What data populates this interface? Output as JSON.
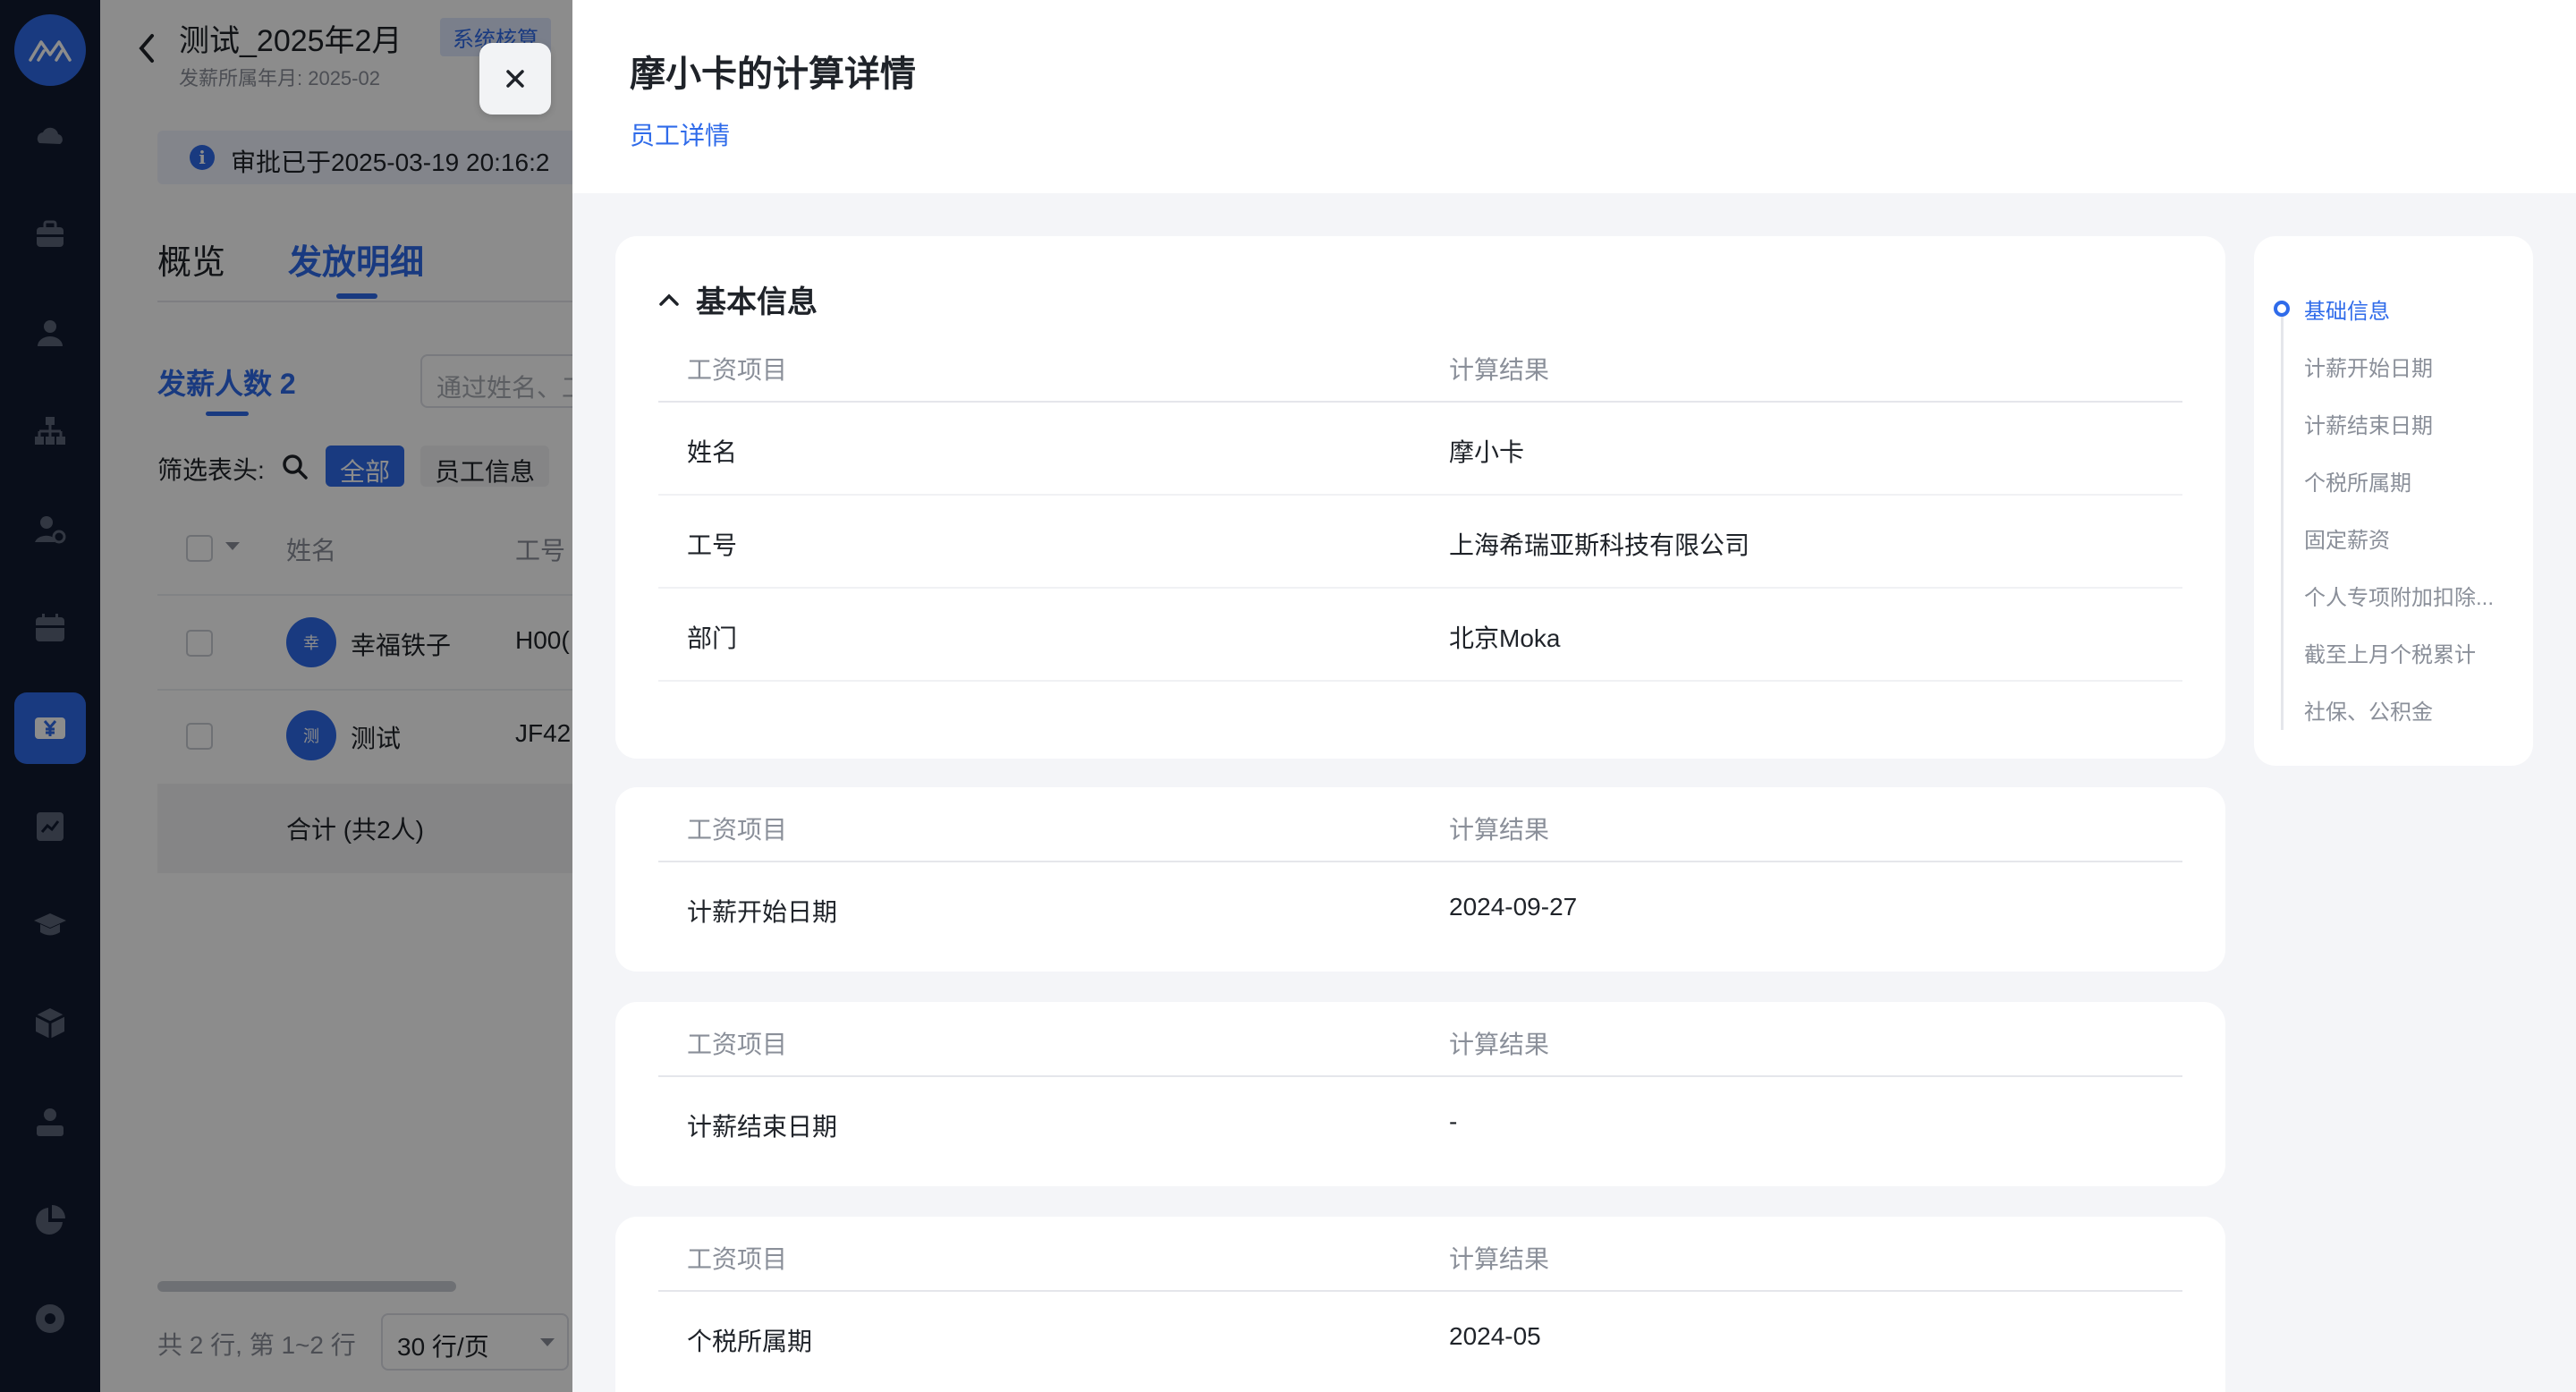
{
  "sidebar": {
    "icons": [
      "logo-icon",
      "cloud-icon",
      "briefcase-icon",
      "user-icon",
      "org-chart-icon",
      "user-settings-icon",
      "calendar-icon",
      "yen-icon",
      "report-icon",
      "graduation-cap-icon",
      "cube-icon",
      "profile-icon",
      "pie-chart-icon",
      "disc-icon"
    ],
    "active_icon": "yen-icon"
  },
  "background_page": {
    "title": "测试_2025年2月",
    "badge": "系统核算",
    "meta": "发薪所属年月: 2025-02",
    "notice": "审批已于2025-03-19 20:16:2",
    "tabs": [
      "概览",
      "发放明细"
    ],
    "active_tab": "发放明细",
    "count_tab": "发薪人数 2",
    "search_placeholder": "通过姓名、工",
    "filter_label": "筛选表头:",
    "filter_chips": [
      "全部",
      "员工信息"
    ],
    "table_headers": [
      "姓名",
      "工号"
    ],
    "rows": [
      {
        "avatar": "幸",
        "name": "幸福铁子",
        "id": "H00("
      },
      {
        "avatar": "测",
        "name": "测试",
        "id": "JF42"
      }
    ],
    "total": "合计 (共2人)",
    "pagination_text": "共 2 行, 第 1~2 行",
    "page_size": "30 行/页"
  },
  "drawer": {
    "title": "摩小卡的计算详情",
    "link": "员工详情",
    "header_item": "工资项目",
    "header_result": "计算结果",
    "basic_section_title": "基本信息",
    "basic_rows": [
      {
        "item": "姓名",
        "value": "摩小卡"
      },
      {
        "item": "工号",
        "value": "上海希瑞亚斯科技有限公司"
      },
      {
        "item": "部门",
        "value": "北京Moka"
      }
    ],
    "start_date": {
      "item": "计薪开始日期",
      "value": "2024-09-27"
    },
    "end_date": {
      "item": "计薪结束日期",
      "value": "-"
    },
    "tax_period": {
      "item": "个税所属期",
      "value": "2024-05"
    }
  },
  "anchors": {
    "items": [
      "基础信息",
      "计薪开始日期",
      "计薪结束日期",
      "个税所属期",
      "固定薪资",
      "个人专项附加扣除...",
      "截至上月个税累计",
      "社保、公积金"
    ],
    "active": "基础信息"
  },
  "colors": {
    "accent": "#2f6bea",
    "rail": "#121b30"
  }
}
